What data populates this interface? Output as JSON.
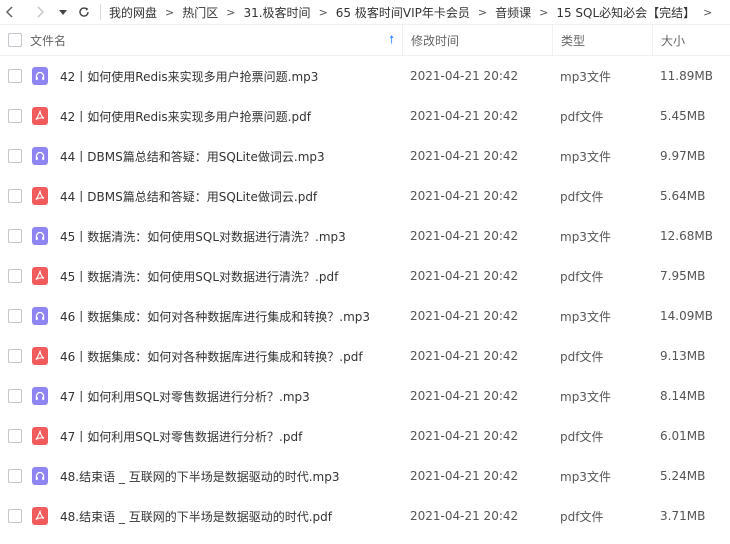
{
  "breadcrumbs": [
    "我的网盘",
    "热门区",
    "31.极客时间",
    "65 极客时间VIP年卡会员",
    "音频课",
    "15 SQL必知必会【完结】"
  ],
  "columns": {
    "name": "文件名",
    "modified": "修改时间",
    "type": "类型",
    "size": "大小"
  },
  "colors": {
    "mp3_icon": "#8e85f2",
    "pdf_icon": "#f05b5b",
    "sort_arrow": "#3b8cff"
  },
  "files": [
    {
      "name": "42丨如何使用Redis来实现多用户抢票问题.mp3",
      "time": "2021-04-21 20:42",
      "type": "mp3文件",
      "size": "11.89MB",
      "icon": "mp3"
    },
    {
      "name": "42丨如何使用Redis来实现多用户抢票问题.pdf",
      "time": "2021-04-21 20:42",
      "type": "pdf文件",
      "size": "5.45MB",
      "icon": "pdf"
    },
    {
      "name": "44丨DBMS篇总结和答疑：用SQLite做词云.mp3",
      "time": "2021-04-21 20:42",
      "type": "mp3文件",
      "size": "9.97MB",
      "icon": "mp3"
    },
    {
      "name": "44丨DBMS篇总结和答疑：用SQLite做词云.pdf",
      "time": "2021-04-21 20:42",
      "type": "pdf文件",
      "size": "5.64MB",
      "icon": "pdf"
    },
    {
      "name": "45丨数据清洗：如何使用SQL对数据进行清洗？.mp3",
      "time": "2021-04-21 20:42",
      "type": "mp3文件",
      "size": "12.68MB",
      "icon": "mp3"
    },
    {
      "name": "45丨数据清洗：如何使用SQL对数据进行清洗？.pdf",
      "time": "2021-04-21 20:42",
      "type": "pdf文件",
      "size": "7.95MB",
      "icon": "pdf"
    },
    {
      "name": "46丨数据集成：如何对各种数据库进行集成和转换？.mp3",
      "time": "2021-04-21 20:42",
      "type": "mp3文件",
      "size": "14.09MB",
      "icon": "mp3"
    },
    {
      "name": "46丨数据集成：如何对各种数据库进行集成和转换？.pdf",
      "time": "2021-04-21 20:42",
      "type": "pdf文件",
      "size": "9.13MB",
      "icon": "pdf"
    },
    {
      "name": "47丨如何利用SQL对零售数据进行分析？.mp3",
      "time": "2021-04-21 20:42",
      "type": "mp3文件",
      "size": "8.14MB",
      "icon": "mp3"
    },
    {
      "name": "47丨如何利用SQL对零售数据进行分析？.pdf",
      "time": "2021-04-21 20:42",
      "type": "pdf文件",
      "size": "6.01MB",
      "icon": "pdf"
    },
    {
      "name": "48.结束语 _ 互联网的下半场是数据驱动的时代.mp3",
      "time": "2021-04-21 20:42",
      "type": "mp3文件",
      "size": "5.24MB",
      "icon": "mp3"
    },
    {
      "name": "48.结束语 _ 互联网的下半场是数据驱动的时代.pdf",
      "time": "2021-04-21 20:42",
      "type": "pdf文件",
      "size": "3.71MB",
      "icon": "pdf"
    }
  ]
}
